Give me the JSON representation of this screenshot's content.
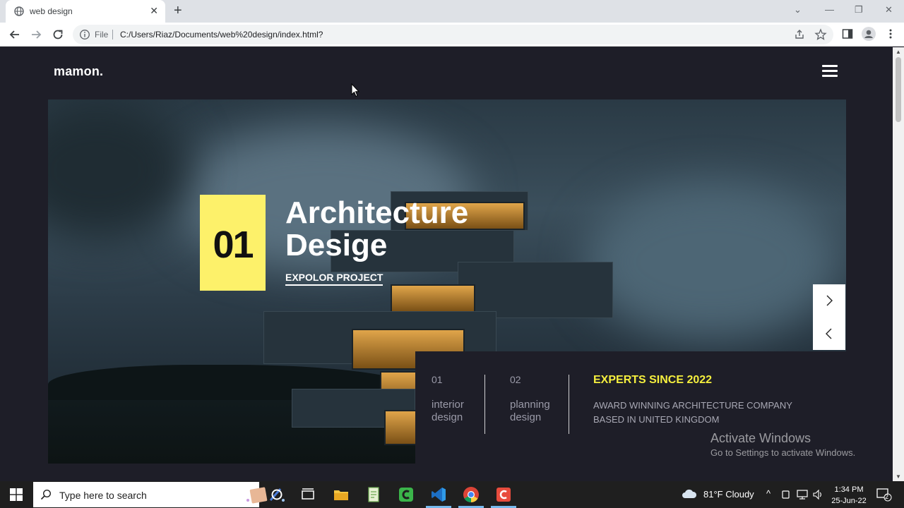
{
  "browser": {
    "tab_title": "web design",
    "tab_close": "✕",
    "new_tab": "+",
    "window_controls": {
      "minimize": "—",
      "restore": "❐",
      "close": "✕",
      "tab_search": "⌄"
    },
    "omnibox": {
      "scheme_label": "File",
      "url": "C:/Users/Riaz/Documents/web%20design/index.html?"
    }
  },
  "site": {
    "logo": "mamon.",
    "slide": {
      "number": "01",
      "title_line1": "Architecture",
      "title_line2": "Desige",
      "cta": "EXPOLOR PROJECT"
    },
    "features": [
      {
        "num": "01",
        "label_line1": "interior",
        "label_line2": "design"
      },
      {
        "num": "02",
        "label_line1": "planning",
        "label_line2": "design"
      }
    ],
    "experts_heading": "EXPERTS SINCE 2022",
    "award_line1": "AWARD WINNING ARCHITECTURE COMPANY",
    "award_line2": "BASED IN UNITED KINGDOM",
    "accent_color": "#fdf16a"
  },
  "watermark": {
    "title": "Activate Windows",
    "subtitle": "Go to Settings to activate Windows."
  },
  "taskbar": {
    "search_placeholder": "Type here to search",
    "weather": "81°F  Cloudy",
    "time": "1:34 PM",
    "date": "25-Jun-22",
    "notification_count": "2"
  }
}
